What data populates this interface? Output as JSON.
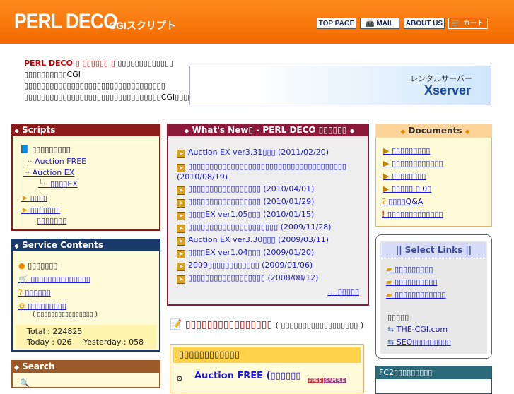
{
  "header": {
    "logo": "PERL DECO",
    "logo_sub": "CGIスクリプト",
    "nav": [
      "TOP PAGE",
      "📠 MAIL",
      "ABOUT US",
      "🛒 カート"
    ]
  },
  "intro": {
    "brand": "PERL DECO ▯ ▯▯▯▯▯▯ ▯",
    "line1": " ▯▯▯▯▯▯▯▯▯▯▯▯▯",
    "line2": "▯▯▯▯▯▯▯▯▯▯CGI ▯▯▯▯▯▯▯▯▯▯▯▯▯▯▯▯▯▯▯▯▯▯▯▯▯▯▯▯▯▯▯▯▯",
    "line3": "▯▯▯▯▯▯▯▯▯▯▯▯▯▯▯▯▯▯▯▯▯▯▯▯▯▯▯▯▯▯▯▯CGI▯▯▯▯▯▯▯▯▯"
  },
  "ad": {
    "sub": "レンタルサーバー",
    "name": "Xserver"
  },
  "scripts": {
    "title": "Scripts",
    "root": "▯▯▯▯▯▯▯▯▯",
    "children": [
      "Auction FREE",
      "Auction EX"
    ],
    "grandchild": "▯▯▯▯EX",
    "links": [
      "▯▯▯▯",
      "▯▯▯▯▯▯▯",
      "▯▯▯▯▯▯▯"
    ]
  },
  "service": {
    "title": "Service Contents",
    "items": [
      "▯▯▯▯▯▯▯",
      "▯▯▯▯▯▯▯▯▯▯▯▯▯▯",
      "▯▯▯▯▯▯",
      "▯▯▯▯▯▯▯▯▯"
    ],
    "note": "( ▯▯▯▯▯▯▯▯▯▯▯▯▯▯▯▯ )",
    "total": "Total : 224825",
    "today": "Today : 026",
    "yesterday": "Yesterday : 058"
  },
  "search": {
    "title": "Search"
  },
  "whatsnew": {
    "title": "What's New▯ - PERL DECO ▯▯▯▯▯▯",
    "items": [
      {
        "text": "Auction EX ver3.31▯▯▯ (2011/02/20)"
      },
      {
        "text": "▯▯▯▯▯▯▯▯▯▯▯▯▯▯▯▯▯▯▯▯▯▯▯▯▯▯▯▯▯▯▯▯▯▯▯▯▯ (2010/08/19)"
      },
      {
        "text": "▯▯▯▯▯▯▯▯▯▯▯▯▯▯▯▯▯ (2010/04/01)"
      },
      {
        "text": "▯▯▯▯▯▯▯▯▯▯▯▯▯▯▯▯▯ (2010/01/29)"
      },
      {
        "text": "▯▯▯▯EX ver1.05▯▯▯ (2010/01/15)"
      },
      {
        "text": "▯▯▯▯▯▯▯▯▯▯▯▯▯▯▯▯▯▯▯▯▯ (2009/11/28)"
      },
      {
        "text": "Auction EX ver3.30▯▯▯ (2009/03/11)"
      },
      {
        "text": "▯▯▯▯EX ver1.04▯▯▯ (2009/01/20)"
      },
      {
        "text": "2009▯▯▯▯▯▯▯▯▯▯▯▯ (2009/01/06)"
      },
      {
        "text": "▯▯▯▯▯▯▯▯▯▯▯▯▯▯▯▯▯▯ (2008/08/12)"
      }
    ],
    "more": "… ▯▯▯▯▯"
  },
  "documents": {
    "title": "Documents",
    "items": [
      "▯▯▯▯▯▯▯▯▯",
      "▯▯▯▯▯▯▯▯▯▯▯▯",
      "▯▯▯▯▯▯▯▯",
      "▯▯▯▯▯ ▯ 0▯",
      "▯▯▯▯Q&A",
      "▯▯▯▯▯▯▯▯▯▯▯▯▯"
    ]
  },
  "select_links": {
    "title": "|| Select Links ||",
    "folders": [
      "▯▯▯▯▯▯▯▯▯",
      "▯▯▯▯▯▯▯▯▯▯",
      "▯▯▯▯▯▯▯▯▯▯▯▯"
    ],
    "sub_title": "▯▯▯▯▯",
    "links": [
      "THE-CGI.com",
      "SEO▯▯▯▯▯▯▯▯▯"
    ]
  },
  "fc2": {
    "title": "FC2▯▯▯▯▯▯▯▯▯"
  },
  "featured": {
    "title": "▯▯▯▯▯▯▯▯▯▯▯▯▯▯▯▯",
    "subtitle": "( ▯▯▯▯▯▯▯▯▯▯▯▯▯▯▯▯▯▯ )",
    "box_header": "▯▯▯▯▯▯▯▯▯▯▯▯",
    "item": "Auction FREE (▯▯▯▯▯▯",
    "badge1": "FREE",
    "badge2": "SAMPLE"
  },
  "colors": {
    "header": "#f26a00",
    "scripts": "#8b1a1a",
    "service": "#1a3a6a",
    "whatsnew": "#8b1a3a",
    "link": "#1a1ad0"
  }
}
